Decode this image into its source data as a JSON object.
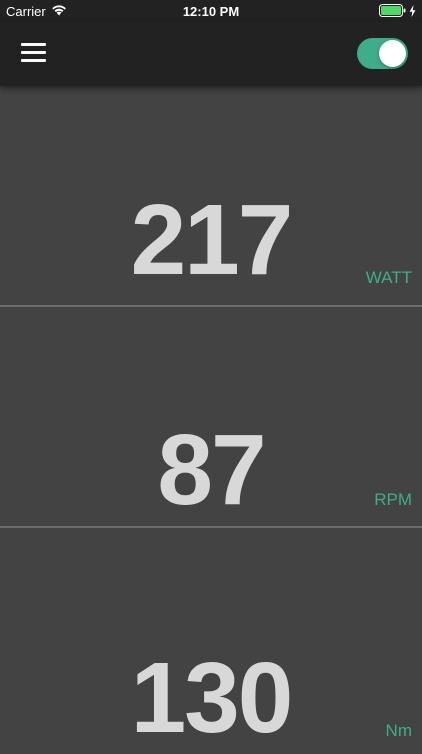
{
  "status_bar": {
    "carrier": "Carrier",
    "time": "12:10 PM"
  },
  "navbar": {
    "toggle_on": true
  },
  "metrics": [
    {
      "value": "217",
      "unit": "WATT"
    },
    {
      "value": "87",
      "unit": "RPM"
    },
    {
      "value": "130",
      "unit": "Nm"
    }
  ],
  "colors": {
    "accent": "#3dae89",
    "background": "#434343",
    "bar": "#222222",
    "value_text": "#d8d8d8"
  }
}
